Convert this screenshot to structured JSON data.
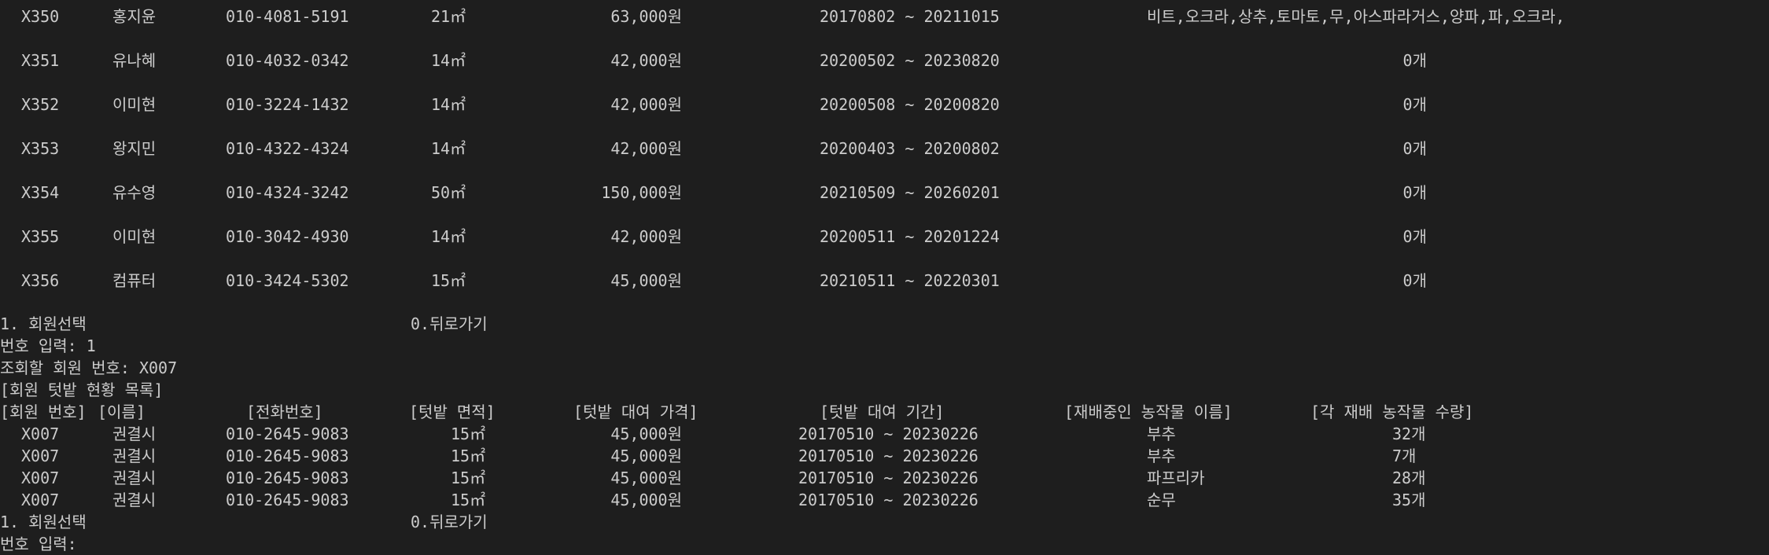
{
  "top_table": {
    "rows": [
      {
        "id": "X350",
        "name": "홍지윤",
        "phone": "010-4081-5191",
        "area": "21㎡",
        "price": "63,000원",
        "period": "20170802 ~ 20211015",
        "crops": "비트,오크라,상추,토마토,무,아스파라거스,양파,파,오크라,"
      },
      {
        "id": "X351",
        "name": "유나혜",
        "phone": "010-4032-0342",
        "area": "14㎡",
        "price": "42,000원",
        "period": "20200502 ~ 20230820",
        "crops": "0개"
      },
      {
        "id": "X352",
        "name": "이미현",
        "phone": "010-3224-1432",
        "area": "14㎡",
        "price": "42,000원",
        "period": "20200508 ~ 20200820",
        "crops": "0개"
      },
      {
        "id": "X353",
        "name": "왕지민",
        "phone": "010-4322-4324",
        "area": "14㎡",
        "price": "42,000원",
        "period": "20200403 ~ 20200802",
        "crops": "0개"
      },
      {
        "id": "X354",
        "name": "유수영",
        "phone": "010-4324-3242",
        "area": "50㎡",
        "price": "150,000원",
        "period": "20210509 ~ 20260201",
        "crops": "0개"
      },
      {
        "id": "X355",
        "name": "이미현",
        "phone": "010-3042-4930",
        "area": "14㎡",
        "price": "42,000원",
        "period": "20200511 ~ 20201224",
        "crops": "0개"
      },
      {
        "id": "X356",
        "name": "컴퓨터",
        "phone": "010-3424-5302",
        "area": "15㎡",
        "price": "45,000원",
        "period": "20210511 ~ 20220301",
        "crops": "0개"
      }
    ]
  },
  "menu1": {
    "select": "1. 회원선택",
    "back": "0.뒤로가기"
  },
  "prompt_number_input": "번호 입력: 1",
  "prompt_member_query": "조회할 회원 번호: X007",
  "list_title": "[회원 텃밭 현황 목록]",
  "detail_headers": {
    "member_no": "[회원 번호]",
    "name": "[이름]",
    "phone": "[전화번호]",
    "area": "[텃밭 면적]",
    "price": "[텃밭 대여 가격]",
    "period": "[텃밭 대여 기간]",
    "crop_name": "[재배중인 농작물 이름]",
    "crop_qty": "[각 재배 농작물 수량]"
  },
  "detail_rows": [
    {
      "id": "X007",
      "name": "권결시",
      "phone": "010-2645-9083",
      "area": "15㎡",
      "price": "45,000원",
      "period": "20170510 ~ 20230226",
      "crop": "부추",
      "qty": "32개"
    },
    {
      "id": "X007",
      "name": "권결시",
      "phone": "010-2645-9083",
      "area": "15㎡",
      "price": "45,000원",
      "period": "20170510 ~ 20230226",
      "crop": "부추",
      "qty": "7개"
    },
    {
      "id": "X007",
      "name": "권결시",
      "phone": "010-2645-9083",
      "area": "15㎡",
      "price": "45,000원",
      "period": "20170510 ~ 20230226",
      "crop": "파프리카",
      "qty": "28개"
    },
    {
      "id": "X007",
      "name": "권결시",
      "phone": "010-2645-9083",
      "area": "15㎡",
      "price": "45,000원",
      "period": "20170510 ~ 20230226",
      "crop": "순무",
      "qty": "35개"
    }
  ],
  "menu2": {
    "select": "1. 회원선택",
    "back": "0.뒤로가기"
  },
  "prompt_number_input_2": "번호 입력:"
}
